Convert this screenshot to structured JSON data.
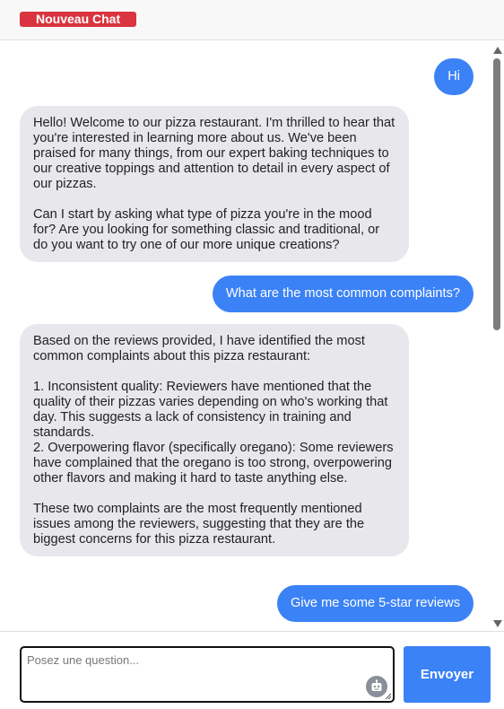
{
  "header": {
    "new_chat_label": "Nouveau Chat"
  },
  "messages": [
    {
      "role": "user",
      "text": "Hi"
    },
    {
      "role": "bot",
      "text": "Hello! Welcome to our pizza restaurant. I'm thrilled to hear that you're interested in learning more about us. We've been praised for many things, from our expert baking techniques to our creative toppings and attention to detail in every aspect of our pizzas.\n\nCan I start by asking what type of pizza you're in the mood for? Are you looking for something classic and traditional, or do you want to try one of our more unique creations?"
    },
    {
      "role": "user",
      "text": "What are the most common complaints?"
    },
    {
      "role": "bot",
      "text": "Based on the reviews provided, I have identified the most common complaints about this pizza restaurant:\n\n1. Inconsistent quality: Reviewers have mentioned that the quality of their pizzas varies depending on who's working that day. This suggests a lack of consistency in training and standards.\n2. Overpowering flavor (specifically oregano): Some reviewers have complained that the oregano is too strong, overpowering other flavors and making it hard to taste anything else.\n\nThese two complaints are the most frequently mentioned issues among the reviewers, suggesting that they are the biggest concerns for this pizza restaurant."
    },
    {
      "role": "user",
      "text": "Give me some 5-star reviews"
    }
  ],
  "composer": {
    "placeholder": "Posez une question...",
    "value": "",
    "send_label": "Envoyer",
    "bot_icon": "robot-icon"
  },
  "colors": {
    "accent": "#3b82f6",
    "new_chat": "#d9343f",
    "bot_bubble": "#e8e8ec"
  }
}
